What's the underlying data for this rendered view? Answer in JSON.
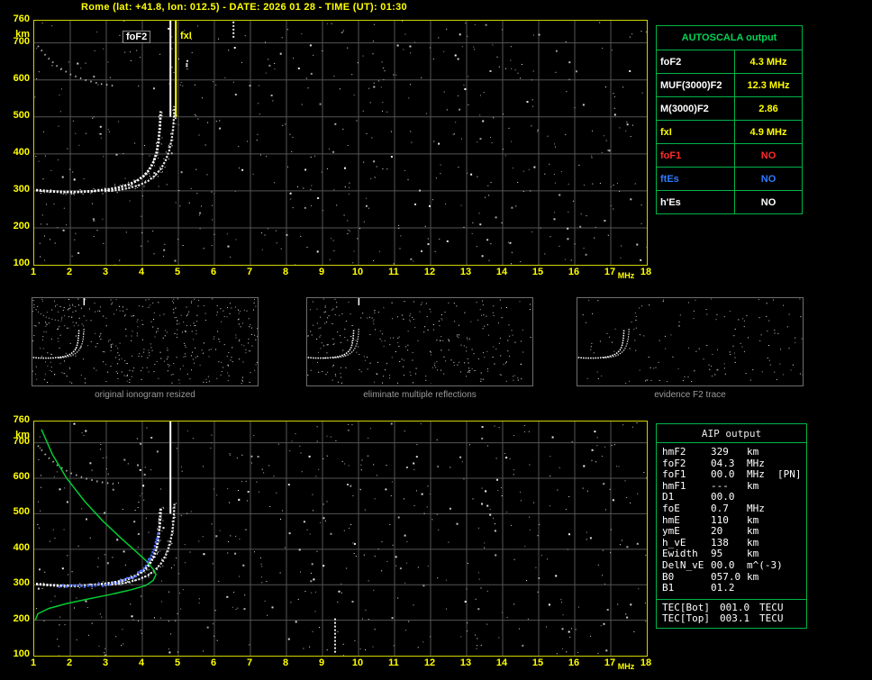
{
  "title": "Rome (lat: +41.8, lon: 012.5) - DATE: 2026 01 28 - TIME (UT): 01:30",
  "axes": {
    "x_ticks": [
      1,
      2,
      3,
      4,
      5,
      6,
      7,
      8,
      9,
      10,
      11,
      12,
      13,
      14,
      15,
      16,
      17,
      18
    ],
    "x_unit": "MHz",
    "y_ticks": [
      760,
      700,
      600,
      500,
      400,
      300,
      200,
      100
    ],
    "y_unit": "km",
    "x_range_mhz": [
      1,
      18
    ],
    "y_range_km": [
      100,
      760
    ]
  },
  "markers": {
    "foF2_label": "foF2",
    "fxI_label": "fxI",
    "white_line_mhz": 4.78,
    "yellow_line_mhz": 4.93,
    "line_bottom_km": 500
  },
  "colors": {
    "grid": "#545454",
    "axis_text": "#ffff00",
    "plot_border": "#d2d200",
    "trace": "#ffffff",
    "echo": "#cfcfcf",
    "profile": "#00cc33",
    "fitted": "#4a6bff",
    "table_border": "#00b44a",
    "header_green": "#00d455",
    "caption_gray": "#9a9a9a"
  },
  "traces": {
    "o_trace": [
      [
        1.05,
        302
      ],
      [
        1.4,
        299
      ],
      [
        1.8,
        297
      ],
      [
        2.2,
        297
      ],
      [
        2.6,
        299
      ],
      [
        3.0,
        303
      ],
      [
        3.3,
        308
      ],
      [
        3.6,
        316
      ],
      [
        3.85,
        327
      ],
      [
        4.05,
        341
      ],
      [
        4.2,
        358
      ],
      [
        4.32,
        380
      ],
      [
        4.4,
        405
      ],
      [
        4.45,
        435
      ],
      [
        4.48,
        465
      ],
      [
        4.5,
        495
      ],
      [
        4.51,
        515
      ]
    ],
    "x_trace": [
      [
        2.95,
        299
      ],
      [
        3.3,
        302
      ],
      [
        3.6,
        307
      ],
      [
        3.9,
        315
      ],
      [
        4.15,
        326
      ],
      [
        4.35,
        341
      ],
      [
        4.52,
        360
      ],
      [
        4.65,
        383
      ],
      [
        4.75,
        410
      ],
      [
        4.82,
        442
      ],
      [
        4.86,
        475
      ],
      [
        4.88,
        505
      ],
      [
        4.89,
        528
      ]
    ],
    "echo": [
      [
        1.1,
        692
      ],
      [
        1.35,
        662
      ],
      [
        1.65,
        636
      ],
      [
        2.0,
        615
      ],
      [
        2.4,
        600
      ],
      [
        2.8,
        590
      ],
      [
        3.2,
        584
      ]
    ],
    "profile": [
      [
        1.2,
        738
      ],
      [
        1.5,
        668
      ],
      [
        1.9,
        600
      ],
      [
        2.4,
        535
      ],
      [
        2.9,
        480
      ],
      [
        3.4,
        432
      ],
      [
        3.8,
        396
      ],
      [
        4.1,
        368
      ],
      [
        4.3,
        344
      ],
      [
        4.38,
        329
      ],
      [
        4.3,
        312
      ],
      [
        4.1,
        298
      ],
      [
        3.7,
        286
      ],
      [
        3.1,
        272
      ],
      [
        2.5,
        260
      ],
      [
        1.9,
        247
      ],
      [
        1.4,
        233
      ],
      [
        1.1,
        218
      ],
      [
        1.03,
        200
      ]
    ],
    "fitted": [
      [
        1.7,
        297
      ],
      [
        2.0,
        295
      ],
      [
        2.3,
        295
      ],
      [
        2.6,
        297
      ],
      [
        2.9,
        300
      ],
      [
        3.2,
        305
      ],
      [
        3.5,
        313
      ],
      [
        3.75,
        323
      ],
      [
        3.95,
        337
      ],
      [
        4.1,
        354
      ],
      [
        4.22,
        375
      ],
      [
        4.32,
        400
      ],
      [
        4.4,
        425
      ],
      [
        4.45,
        448
      ]
    ]
  },
  "top_plot": {
    "seed": 20260128,
    "noise": 560,
    "interference": [
      {
        "mhz": 6.53,
        "km": [
          712,
          758
        ]
      }
    ]
  },
  "bottom_plot": {
    "seed": 19750412,
    "noise": 560,
    "interference": [
      {
        "mhz": 9.35,
        "km": [
          108,
          205
        ]
      }
    ]
  },
  "thumbnails": [
    {
      "caption": "original ionogram resized",
      "seed": 11,
      "noise": 430,
      "echo": true,
      "vline": true
    },
    {
      "caption": "eliminate multiple reflections",
      "seed": 22,
      "noise": 310,
      "echo": false,
      "vline": true
    },
    {
      "caption": "evidence F2 trace",
      "seed": 33,
      "noise": 150,
      "echo": false,
      "vline": false
    }
  ],
  "autoscala": {
    "header": "AUTOSCALA output",
    "rows": [
      {
        "label": "foF2",
        "value": "4.3 MHz",
        "label_color": "#ffffff",
        "value_color": "#ffff00"
      },
      {
        "label": "MUF(3000)F2",
        "value": "12.3 MHz",
        "label_color": "#ffffff",
        "value_color": "#ffff00"
      },
      {
        "label": "M(3000)F2",
        "value": "2.86",
        "label_color": "#ffffff",
        "value_color": "#ffff00"
      },
      {
        "label": "fxI",
        "value": "4.9 MHz",
        "label_color": "#ffff00",
        "value_color": "#ffff00"
      },
      {
        "label": "foF1",
        "value": "NO",
        "label_color": "#ff2a2a",
        "value_color": "#ff2a2a"
      },
      {
        "label": "ftEs",
        "value": "NO",
        "label_color": "#2e7bff",
        "value_color": "#2e7bff"
      },
      {
        "label": "h'Es",
        "value": "NO",
        "label_color": "#ffffff",
        "value_color": "#ffffff"
      }
    ]
  },
  "aip": {
    "header": "AIP output",
    "rows": [
      [
        "hmF2",
        "329",
        "km",
        ""
      ],
      [
        "foF2",
        "04.3",
        "MHz",
        ""
      ],
      [
        "foF1",
        "00.0",
        "MHz",
        "[PN]"
      ],
      [
        "hmF1",
        "---",
        "km",
        ""
      ],
      [
        "D1",
        "00.0",
        "",
        ""
      ],
      [
        "foE",
        "0.7",
        "MHz",
        ""
      ],
      [
        "hmE",
        "110",
        "km",
        ""
      ],
      [
        "ymE",
        "20",
        "km",
        ""
      ],
      [
        "h_vE",
        "138",
        "km",
        ""
      ],
      [
        "Ewidth",
        "95",
        "km",
        ""
      ],
      [
        "DelN_vE",
        "00.0",
        "m^(-3)",
        ""
      ],
      [
        "B0",
        "057.0",
        "km",
        ""
      ],
      [
        "B1",
        "01.2",
        "",
        ""
      ]
    ],
    "tec_rows": [
      [
        "TEC[Bot]",
        "001.0",
        "TECU"
      ],
      [
        "TEC[Top]",
        "003.1",
        "TECU"
      ]
    ]
  }
}
